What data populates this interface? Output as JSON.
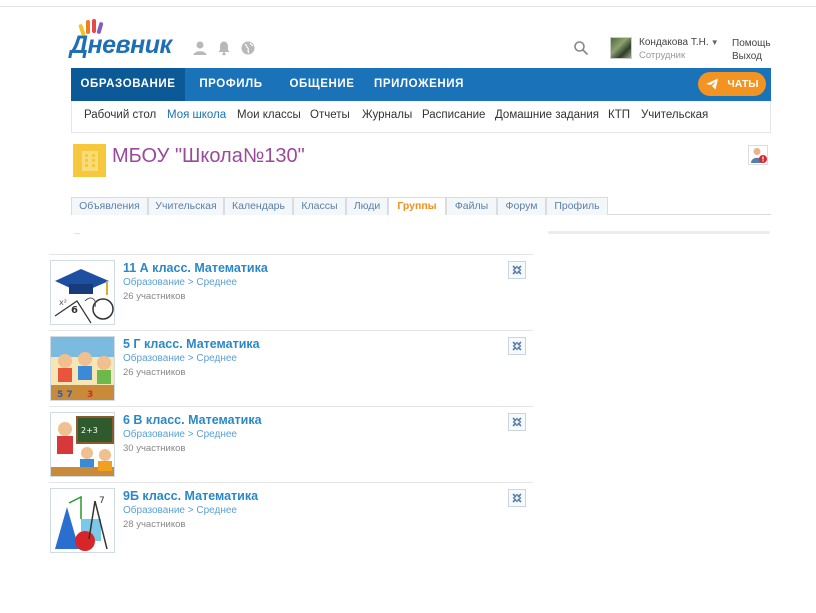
{
  "header": {
    "logo_text": "Дневник",
    "user": {
      "name": "Кондакова Т.Н.",
      "role": "Сотрудник"
    },
    "help_label": "Помощь",
    "exit_label": "Выход",
    "icons": [
      "person-icon",
      "bell-icon",
      "globe-icon",
      "search-icon"
    ]
  },
  "main_nav": {
    "items": [
      {
        "label": "ОБРАЗОВАНИЕ",
        "active": true
      },
      {
        "label": "ПРОФИЛЬ",
        "active": false
      },
      {
        "label": "ОБЩЕНИЕ",
        "active": false
      },
      {
        "label": "ПРИЛОЖЕНИЯ",
        "active": false
      }
    ],
    "chats_label": "ЧАТЫ"
  },
  "sub_nav": {
    "items": [
      {
        "label": "Рабочий стол",
        "active": false
      },
      {
        "label": "Моя школа",
        "active": true
      },
      {
        "label": "Мои классы",
        "active": false
      },
      {
        "label": "Отчеты",
        "active": false
      },
      {
        "label": "Журналы",
        "active": false
      },
      {
        "label": "Расписание",
        "active": false
      },
      {
        "label": "Домашние задания",
        "active": false
      },
      {
        "label": "КТП",
        "active": false
      },
      {
        "label": "Учительская",
        "active": false
      }
    ]
  },
  "school": {
    "title": "МБОУ \"Школа№130\""
  },
  "tabs": {
    "items": [
      {
        "label": "Объявления",
        "active": false
      },
      {
        "label": "Учительская",
        "active": false
      },
      {
        "label": "Календарь",
        "active": false
      },
      {
        "label": "Классы",
        "active": false
      },
      {
        "label": "Люди",
        "active": false
      },
      {
        "label": "Группы",
        "active": true
      },
      {
        "label": "Файлы",
        "active": false
      },
      {
        "label": "Форум",
        "active": false
      },
      {
        "label": "Профиль",
        "active": false
      }
    ]
  },
  "groups": [
    {
      "name": "11 А класс. Математика",
      "category": "Образование > Среднее",
      "members": "26 участников"
    },
    {
      "name": "5 Г класс. Математика",
      "category": "Образование > Среднее",
      "members": "26 участников"
    },
    {
      "name": "6 В класс. Математика",
      "category": "Образование > Среднее",
      "members": "30 участников"
    },
    {
      "name": "9Б класс. Математика",
      "category": "Образование > Среднее",
      "members": "28 участников"
    }
  ],
  "colors": {
    "nav_blue": "#1a72b8",
    "nav_active": "#0b5a97",
    "chats_orange": "#f39322",
    "school_title": "#9a4a9a",
    "link_blue": "#2b88c8",
    "active_tab": "#f09024"
  }
}
